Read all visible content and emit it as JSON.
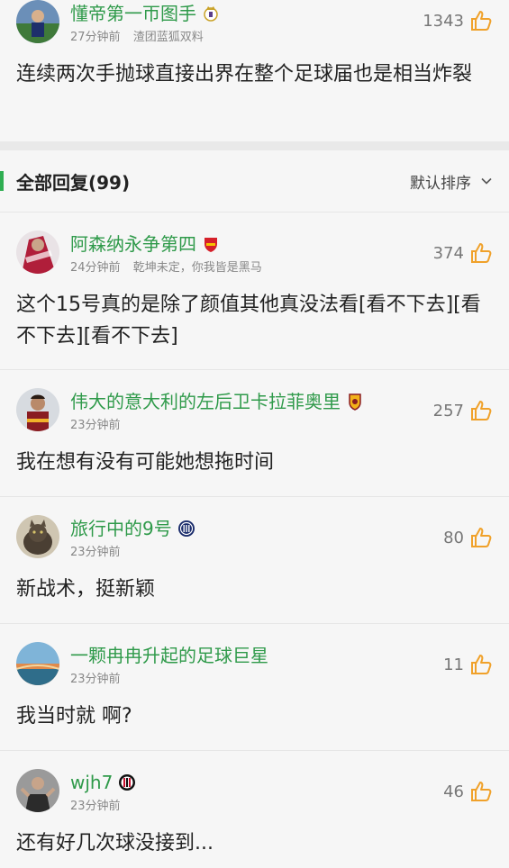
{
  "top_comment": {
    "username": "懂帝第一帀图手",
    "time": "27分钟前",
    "team": "渣团蓝狐双料",
    "likes": "1343",
    "content": "连续两次手抛球直接出界在整个足球届也是相当炸裂",
    "badge_icon": "real-madrid-badge-icon"
  },
  "section": {
    "title": "全部回复(99)",
    "sort_label": "默认排序",
    "accent": "#2fae52"
  },
  "replies": [
    {
      "username": "阿森纳永争第四",
      "time": "24分钟前",
      "note": "乾坤未定，你我皆是黑马",
      "likes": "374",
      "content": "这个15号真的是除了颜值其他真没法看[看不下去][看不下去][看不下去]",
      "badge_icon": "arsenal-badge-icon"
    },
    {
      "username": "伟大的意大利的左后卫卡拉菲奥里",
      "time": "23分钟前",
      "likes": "257",
      "content": "我在想有没有可能她想拖时间",
      "badge_icon": "roma-badge-icon"
    },
    {
      "username": "旅行中的9号",
      "time": "23分钟前",
      "likes": "80",
      "content": "新战术，挺新颖",
      "badge_icon": "inter-badge-icon"
    },
    {
      "username": "一颗冉冉升起的足球巨星",
      "time": "23分钟前",
      "likes": "11",
      "content": "我当时就 啊?"
    },
    {
      "username": "wjh7",
      "time": "23分钟前",
      "likes": "46",
      "content": "还有好几次球没接到...",
      "badge_icon": "ac-milan-badge-icon"
    }
  ],
  "colors": {
    "username": "#2f9a4a",
    "like_thumb": "#f0a12a"
  }
}
